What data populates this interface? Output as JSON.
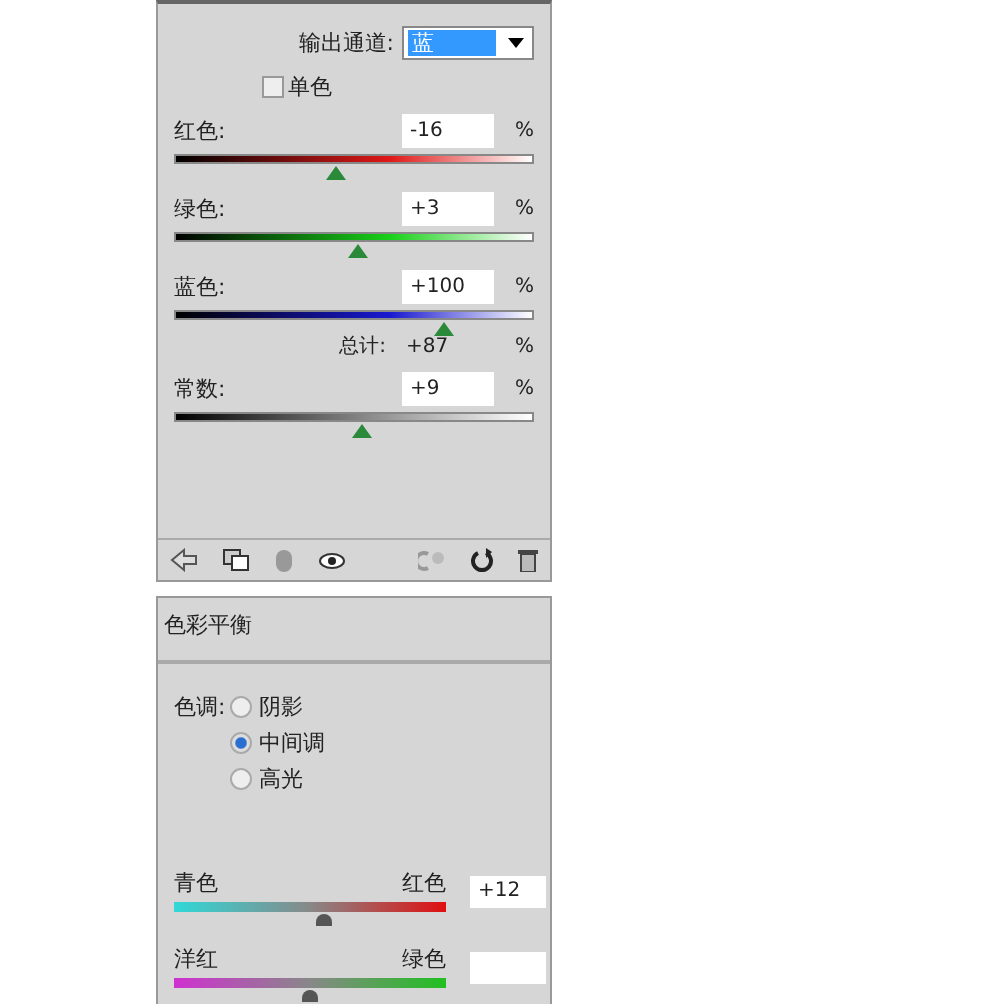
{
  "channel_mixer": {
    "output_channel": {
      "label": "输出通道:",
      "value": "蓝"
    },
    "monochrome": {
      "label": "单色",
      "checked": false
    },
    "sources": [
      {
        "label": "红色:",
        "kind": "red",
        "value": "-16",
        "unit": "%",
        "level": 0.45
      },
      {
        "label": "绿色:",
        "kind": "green",
        "value": "+3",
        "unit": "%",
        "level": 0.51
      },
      {
        "label": "蓝色:",
        "kind": "blue",
        "value": "+100",
        "unit": "%",
        "level": 0.75
      }
    ],
    "total": {
      "label": "总计:",
      "value": "+87",
      "unit": "%"
    },
    "constant": {
      "label": "常数:",
      "kind": "gray",
      "value": "+9",
      "unit": "%",
      "level": 0.52
    }
  },
  "color_balance": {
    "title": "色彩平衡",
    "tone_label": "色调:",
    "tones": [
      {
        "label": "阴影",
        "selected": false
      },
      {
        "label": "中间调",
        "selected": true
      },
      {
        "label": "高光",
        "selected": false
      }
    ],
    "sliders": [
      {
        "left": "青色",
        "right": "红色",
        "kind": "cyanred",
        "value": "+12",
        "level": 0.55
      },
      {
        "left": "洋红",
        "right": "绿色",
        "kind": "magentagreen",
        "level": 0.5
      }
    ]
  }
}
